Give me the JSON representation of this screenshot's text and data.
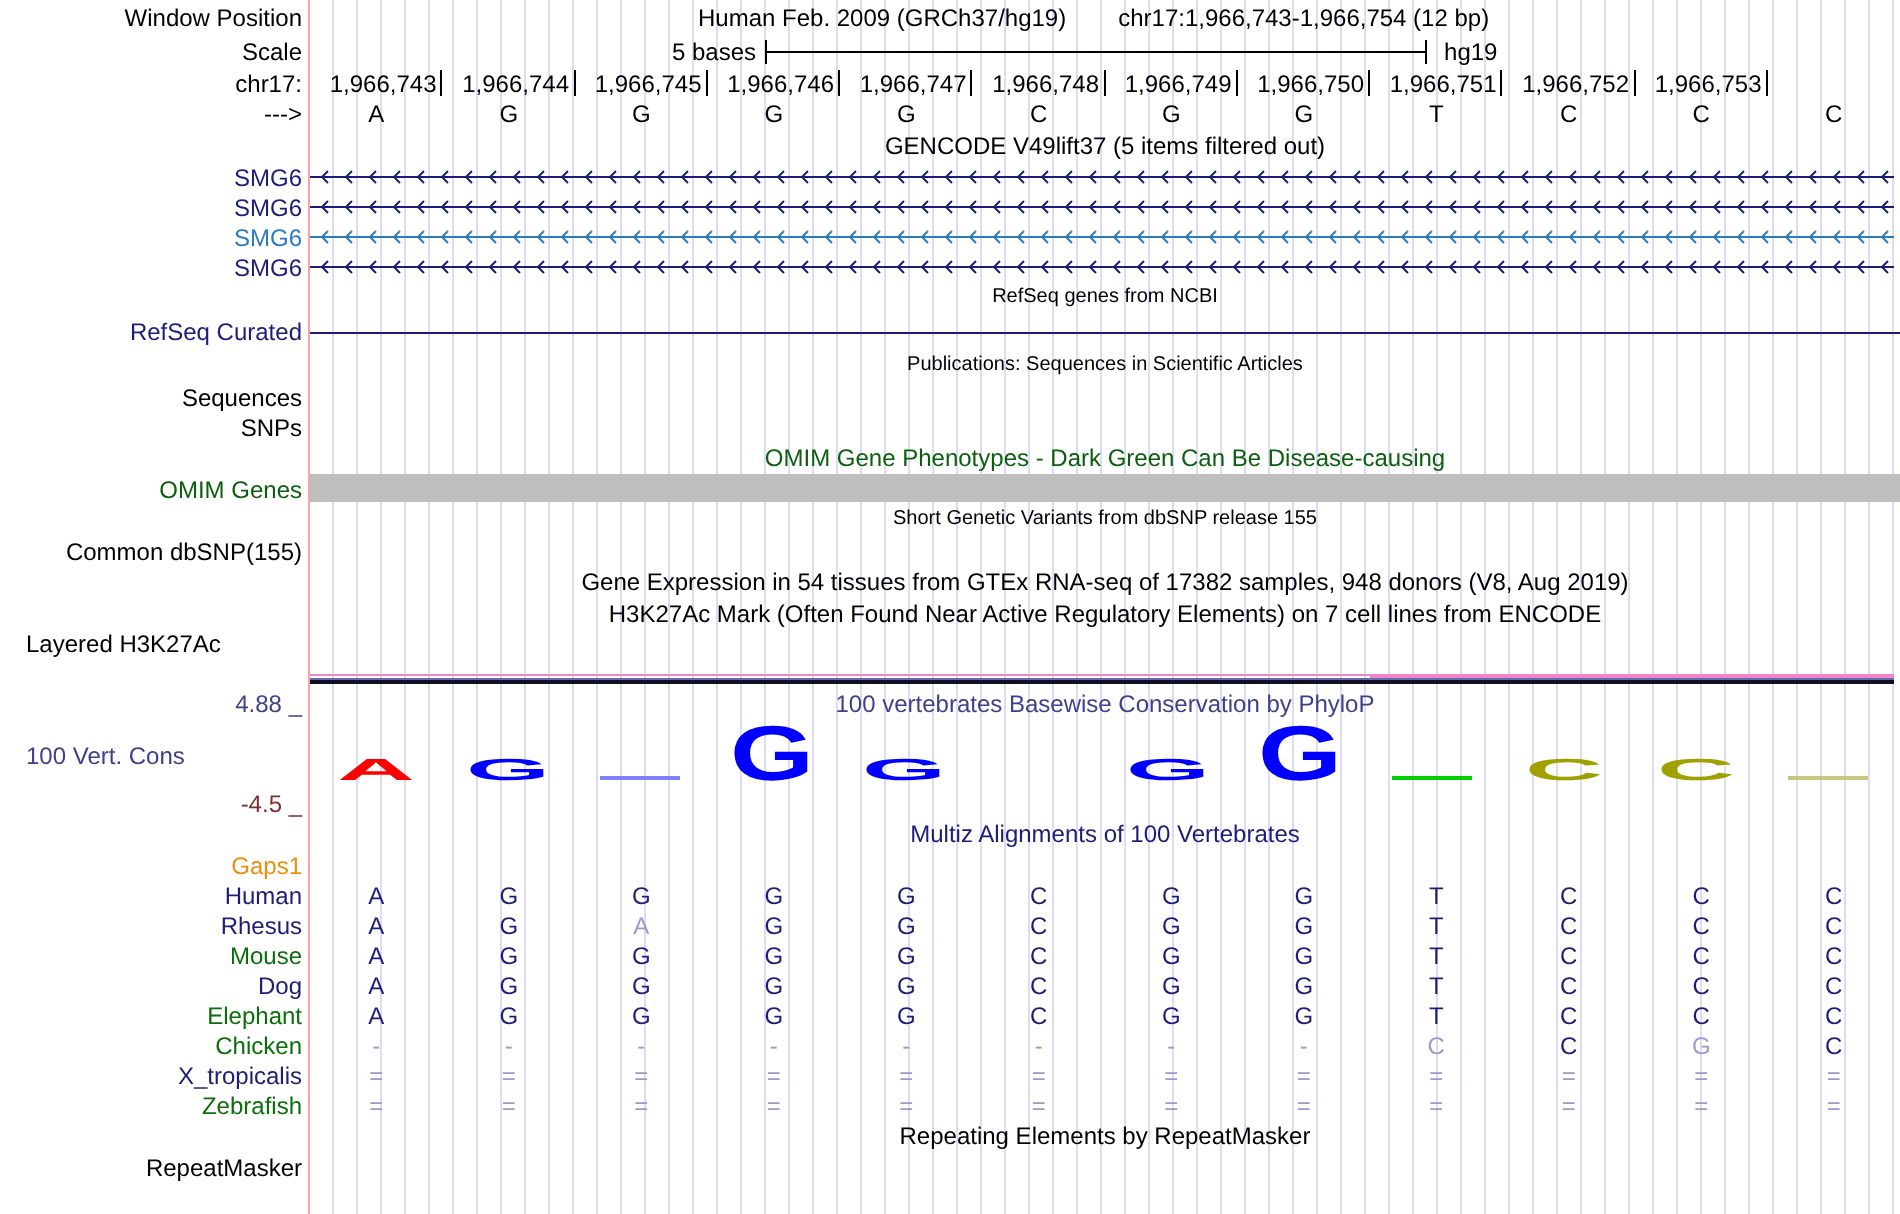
{
  "position_bar": {
    "label": "Window Position",
    "assembly_title": "Human Feb. 2009 (GRCh37/hg19)",
    "range": "chr17:1,966,743-1,966,754 (12 bp)"
  },
  "scale": {
    "label": "Scale",
    "span": "5 bases",
    "assembly": "hg19"
  },
  "coordinates": {
    "label": "chr17:",
    "positions": [
      "1,966,743",
      "1,966,744",
      "1,966,745",
      "1,966,746",
      "1,966,747",
      "1,966,748",
      "1,966,749",
      "1,966,750",
      "1,966,751",
      "1,966,752",
      "1,966,753"
    ]
  },
  "strand": {
    "label": "--->",
    "bases": [
      "A",
      "G",
      "G",
      "G",
      "G",
      "C",
      "G",
      "G",
      "T",
      "C",
      "C",
      "C"
    ]
  },
  "tracks": [
    {
      "kind": "title",
      "text": "GENCODE V49lift37 (5 items filtered out)",
      "color": "#000000"
    },
    {
      "kind": "gene",
      "label": "SMG6",
      "color": "#1d1d78"
    },
    {
      "kind": "gene",
      "label": "SMG6",
      "color": "#1d1d78"
    },
    {
      "kind": "gene",
      "label": "SMG6",
      "color": "#2a7bbf"
    },
    {
      "kind": "gene",
      "label": "SMG6",
      "color": "#1d1d78"
    },
    {
      "kind": "note",
      "text": "RefSeq genes from NCBI",
      "color": "#000000"
    },
    {
      "kind": "line",
      "label": "RefSeq Curated",
      "color": "#1d1d78"
    },
    {
      "kind": "note",
      "text": "Publications: Sequences in Scientific Articles",
      "color": "#000000"
    },
    {
      "kind": "empty",
      "label": "Sequences",
      "color": "#000000"
    },
    {
      "kind": "empty",
      "label": "SNPs",
      "color": "#000000"
    },
    {
      "kind": "title",
      "text": "OMIM Gene Phenotypes - Dark Green Can Be Disease-causing",
      "color": "#0b5e0b"
    },
    {
      "kind": "bar",
      "label": "OMIM Genes",
      "color": "#0b5e0b"
    },
    {
      "kind": "note",
      "text": "Short Genetic Variants from dbSNP release 155",
      "color": "#000000"
    },
    {
      "kind": "empty",
      "label": "Common dbSNP(155)",
      "color": "#000000"
    },
    {
      "kind": "title",
      "text": "Gene Expression in 54 tissues from GTEx RNA-seq of 17382 samples, 948 donors (V8, Aug 2019)",
      "color": "#000000"
    },
    {
      "kind": "title",
      "text": "H3K27Ac Mark (Often Found Near Active Regulatory Elements) on 7 cell lines from ENCODE",
      "color": "#000000"
    },
    {
      "kind": "layered",
      "label": "Layered H3K27Ac"
    },
    {
      "kind": "conservation",
      "label": "100 Vert. Cons",
      "max": "4.88 _",
      "min": "-4.5 _",
      "title": "100 vertebrates Basewise Conservation by PhyloP",
      "letters": [
        {
          "base": "A",
          "kind": "medium",
          "color": "#ff0000"
        },
        {
          "base": "G",
          "kind": "medium",
          "color": "#0000ff"
        },
        {
          "kind": "flat",
          "color": "#8080ff"
        },
        {
          "base": "G",
          "kind": "tall",
          "color": "#0000ff"
        },
        {
          "base": "G",
          "kind": "medium",
          "color": "#0000ff"
        },
        {
          "kind": "gap"
        },
        {
          "base": "G",
          "kind": "medium",
          "color": "#0000ff"
        },
        {
          "base": "G",
          "kind": "tall",
          "color": "#0000ff"
        },
        {
          "kind": "flat",
          "color": "#00d000"
        },
        {
          "base": "C",
          "kind": "medium",
          "color": "#a0a000"
        },
        {
          "base": "C",
          "kind": "medium",
          "color": "#a0a000"
        },
        {
          "kind": "flat",
          "color": "#c8c880"
        }
      ]
    },
    {
      "kind": "title",
      "text": "Multiz Alignments of 100 Vertebrates",
      "color": "#1d1d78"
    },
    {
      "kind": "empty",
      "label": "Gaps1",
      "color": "#e8900c"
    },
    {
      "kind": "species",
      "label": "Human",
      "color": "#1d1d78",
      "bases": [
        {
          "text": "A",
          "faded": false
        },
        {
          "text": "G",
          "faded": false
        },
        {
          "text": "G",
          "faded": false
        },
        {
          "text": "G",
          "faded": false
        },
        {
          "text": "G",
          "faded": false
        },
        {
          "text": "C",
          "faded": false
        },
        {
          "text": "G",
          "faded": false
        },
        {
          "text": "G",
          "faded": false
        },
        {
          "text": "T",
          "faded": false
        },
        {
          "text": "C",
          "faded": false
        },
        {
          "text": "C",
          "faded": false
        },
        {
          "text": "C",
          "faded": false
        }
      ]
    },
    {
      "kind": "species",
      "label": "Rhesus",
      "color": "#1d1d78",
      "bases": [
        {
          "text": "A",
          "faded": false
        },
        {
          "text": "G",
          "faded": false
        },
        {
          "text": "A",
          "faded": true
        },
        {
          "text": "G",
          "faded": false
        },
        {
          "text": "G",
          "faded": false
        },
        {
          "text": "C",
          "faded": false
        },
        {
          "text": "G",
          "faded": false
        },
        {
          "text": "G",
          "faded": false
        },
        {
          "text": "T",
          "faded": false
        },
        {
          "text": "C",
          "faded": false
        },
        {
          "text": "C",
          "faded": false
        },
        {
          "text": "C",
          "faded": false
        }
      ]
    },
    {
      "kind": "species",
      "label": "Mouse",
      "color": "#0b6e0b",
      "bases": [
        {
          "text": "A",
          "faded": false
        },
        {
          "text": "G",
          "faded": false
        },
        {
          "text": "G",
          "faded": false
        },
        {
          "text": "G",
          "faded": false
        },
        {
          "text": "G",
          "faded": false
        },
        {
          "text": "C",
          "faded": false
        },
        {
          "text": "G",
          "faded": false
        },
        {
          "text": "G",
          "faded": false
        },
        {
          "text": "T",
          "faded": false
        },
        {
          "text": "C",
          "faded": false
        },
        {
          "text": "C",
          "faded": false
        },
        {
          "text": "C",
          "faded": false
        }
      ]
    },
    {
      "kind": "species",
      "label": "Dog",
      "color": "#1d1d78",
      "bases": [
        {
          "text": "A",
          "faded": false
        },
        {
          "text": "G",
          "faded": false
        },
        {
          "text": "G",
          "faded": false
        },
        {
          "text": "G",
          "faded": false
        },
        {
          "text": "G",
          "faded": false
        },
        {
          "text": "C",
          "faded": false
        },
        {
          "text": "G",
          "faded": false
        },
        {
          "text": "G",
          "faded": false
        },
        {
          "text": "T",
          "faded": false
        },
        {
          "text": "C",
          "faded": false
        },
        {
          "text": "C",
          "faded": false
        },
        {
          "text": "C",
          "faded": false
        }
      ]
    },
    {
      "kind": "species",
      "label": "Elephant",
      "color": "#0b6e0b",
      "bases": [
        {
          "text": "A",
          "faded": false
        },
        {
          "text": "G",
          "faded": false
        },
        {
          "text": "G",
          "faded": false
        },
        {
          "text": "G",
          "faded": false
        },
        {
          "text": "G",
          "faded": false
        },
        {
          "text": "C",
          "faded": false
        },
        {
          "text": "G",
          "faded": false
        },
        {
          "text": "G",
          "faded": false
        },
        {
          "text": "T",
          "faded": false
        },
        {
          "text": "C",
          "faded": false
        },
        {
          "text": "C",
          "faded": false
        },
        {
          "text": "C",
          "faded": false
        }
      ]
    },
    {
      "kind": "species",
      "label": "Chicken",
      "color": "#0b6e0b",
      "bases": [
        {
          "text": "-",
          "faded": true
        },
        {
          "text": "-",
          "faded": true
        },
        {
          "text": "-",
          "faded": true
        },
        {
          "text": "-",
          "faded": true
        },
        {
          "text": "-",
          "faded": true
        },
        {
          "text": "-",
          "faded": true
        },
        {
          "text": "-",
          "faded": true
        },
        {
          "text": "-",
          "faded": true
        },
        {
          "text": "C",
          "faded": true
        },
        {
          "text": "C",
          "faded": false
        },
        {
          "text": "G",
          "faded": true
        },
        {
          "text": "C",
          "faded": false
        }
      ]
    },
    {
      "kind": "species",
      "label": "X_tropicalis",
      "color": "#1d1d78",
      "bases": [
        {
          "text": "=",
          "faded": true
        },
        {
          "text": "=",
          "faded": true
        },
        {
          "text": "=",
          "faded": true
        },
        {
          "text": "=",
          "faded": true
        },
        {
          "text": "=",
          "faded": true
        },
        {
          "text": "=",
          "faded": true
        },
        {
          "text": "=",
          "faded": true
        },
        {
          "text": "=",
          "faded": true
        },
        {
          "text": "=",
          "faded": true
        },
        {
          "text": "=",
          "faded": true
        },
        {
          "text": "=",
          "faded": true
        },
        {
          "text": "=",
          "faded": true
        }
      ]
    },
    {
      "kind": "species",
      "label": "Zebrafish",
      "color": "#0b6e0b",
      "bases": [
        {
          "text": "=",
          "faded": true
        },
        {
          "text": "=",
          "faded": true
        },
        {
          "text": "=",
          "faded": true
        },
        {
          "text": "=",
          "faded": true
        },
        {
          "text": "=",
          "faded": true
        },
        {
          "text": "=",
          "faded": true
        },
        {
          "text": "=",
          "faded": true
        },
        {
          "text": "=",
          "faded": true
        },
        {
          "text": "=",
          "faded": true
        },
        {
          "text": "=",
          "faded": true
        },
        {
          "text": "=",
          "faded": true
        },
        {
          "text": "=",
          "faded": true
        }
      ]
    },
    {
      "kind": "title",
      "text": "Repeating Elements by RepeatMasker",
      "color": "#000000"
    },
    {
      "kind": "empty",
      "label": "RepeatMasker",
      "color": "#000000"
    }
  ]
}
